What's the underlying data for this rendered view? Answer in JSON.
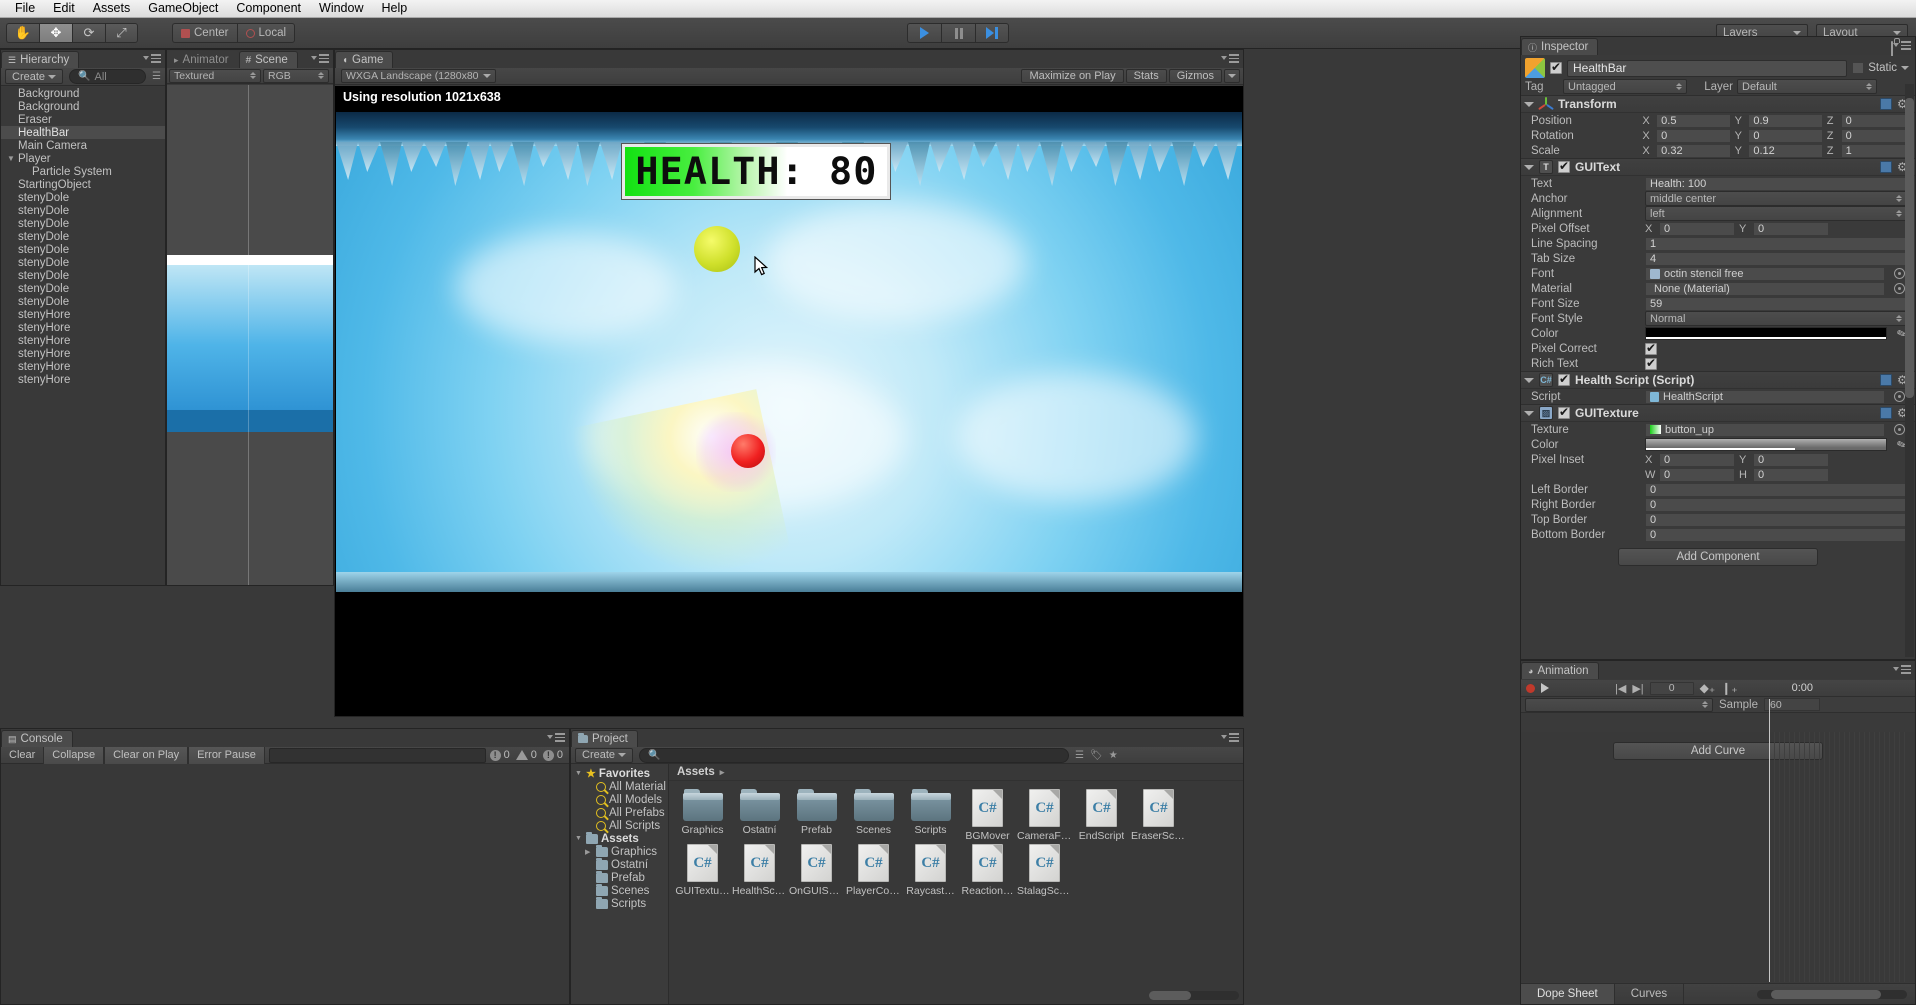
{
  "menubar": {
    "items": [
      "File",
      "Edit",
      "Assets",
      "GameObject",
      "Component",
      "Window",
      "Help"
    ]
  },
  "toolbar": {
    "tools": [
      {
        "name": "hand-tool",
        "glyph": "✋"
      },
      {
        "name": "move-tool",
        "glyph": "✥"
      },
      {
        "name": "rotate-tool",
        "glyph": "⟳"
      },
      {
        "name": "scale-tool",
        "glyph": "⤢"
      }
    ],
    "pivot_mode": "Center",
    "pivot_rotation": "Local",
    "play_label": "Play",
    "pause_label": "Pause",
    "step_label": "Step",
    "layers_label": "Layers",
    "layout_label": "Layout"
  },
  "hierarchy": {
    "tab": "Hierarchy",
    "create_label": "Create",
    "search_placeholder": "All",
    "items": [
      {
        "label": "Background",
        "indent": 0,
        "expandable": false,
        "selected": false
      },
      {
        "label": "Background",
        "indent": 0,
        "expandable": false,
        "selected": false
      },
      {
        "label": "Eraser",
        "indent": 0,
        "expandable": false,
        "selected": false
      },
      {
        "label": "HealthBar",
        "indent": 0,
        "expandable": false,
        "selected": true
      },
      {
        "label": "Main Camera",
        "indent": 0,
        "expandable": false,
        "selected": false
      },
      {
        "label": "Player",
        "indent": 0,
        "expandable": true,
        "selected": false
      },
      {
        "label": "Particle System",
        "indent": 1,
        "expandable": false,
        "selected": false
      },
      {
        "label": "StartingObject",
        "indent": 0,
        "expandable": false,
        "selected": false
      },
      {
        "label": "stenyDole",
        "indent": 0,
        "expandable": false,
        "selected": false
      },
      {
        "label": "stenyDole",
        "indent": 0,
        "expandable": false,
        "selected": false
      },
      {
        "label": "stenyDole",
        "indent": 0,
        "expandable": false,
        "selected": false
      },
      {
        "label": "stenyDole",
        "indent": 0,
        "expandable": false,
        "selected": false
      },
      {
        "label": "stenyDole",
        "indent": 0,
        "expandable": false,
        "selected": false
      },
      {
        "label": "stenyDole",
        "indent": 0,
        "expandable": false,
        "selected": false
      },
      {
        "label": "stenyDole",
        "indent": 0,
        "expandable": false,
        "selected": false
      },
      {
        "label": "stenyDole",
        "indent": 0,
        "expandable": false,
        "selected": false
      },
      {
        "label": "stenyDole",
        "indent": 0,
        "expandable": false,
        "selected": false
      },
      {
        "label": "stenyHore",
        "indent": 0,
        "expandable": false,
        "selected": false
      },
      {
        "label": "stenyHore",
        "indent": 0,
        "expandable": false,
        "selected": false
      },
      {
        "label": "stenyHore",
        "indent": 0,
        "expandable": false,
        "selected": false
      },
      {
        "label": "stenyHore",
        "indent": 0,
        "expandable": false,
        "selected": false
      },
      {
        "label": "stenyHore",
        "indent": 0,
        "expandable": false,
        "selected": false
      },
      {
        "label": "stenyHore",
        "indent": 0,
        "expandable": false,
        "selected": false
      }
    ]
  },
  "scene_panel": {
    "tab_animator": "Animator",
    "tab_scene": "Scene",
    "draw_mode": "Textured",
    "color_mode": "RGB"
  },
  "game_view": {
    "tab": "Game",
    "aspect": "WXGA Landscape (1280x80",
    "maximize_label": "Maximize on Play",
    "stats_label": "Stats",
    "gizmos_label": "Gizmos",
    "resolution_notice": "Using resolution 1021x638",
    "hud_health_text": "HEALTH: 80"
  },
  "console": {
    "tab": "Console",
    "clear_label": "Clear",
    "collapse_label": "Collapse",
    "clear_on_play_label": "Clear on Play",
    "error_pause_label": "Error Pause",
    "count_info": "0",
    "count_warning": "0",
    "count_error": "0"
  },
  "project": {
    "tab": "Project",
    "create_label": "Create",
    "search_placeholder": "",
    "favorites_label": "Favorites",
    "favorites": [
      "All Material",
      "All Models",
      "All Prefabs",
      "All Scripts"
    ],
    "assets_label": "Assets",
    "folders": [
      "Graphics",
      "Ostatní",
      "Prefab",
      "Scenes",
      "Scripts"
    ],
    "breadcrumb": "Assets",
    "items": [
      {
        "name": "Graphics",
        "type": "folder"
      },
      {
        "name": "Ostatní",
        "type": "folder"
      },
      {
        "name": "Prefab",
        "type": "folder"
      },
      {
        "name": "Scenes",
        "type": "folder"
      },
      {
        "name": "Scripts",
        "type": "folder"
      },
      {
        "name": "BGMover",
        "type": "script"
      },
      {
        "name": "CameraFo…",
        "type": "script"
      },
      {
        "name": "EndScript",
        "type": "script"
      },
      {
        "name": "EraserScr…",
        "type": "script"
      },
      {
        "name": "GUITextu…",
        "type": "script"
      },
      {
        "name": "HealthScr…",
        "type": "script"
      },
      {
        "name": "OnGUISc…",
        "type": "script"
      },
      {
        "name": "PlayerCol…",
        "type": "script"
      },
      {
        "name": "Raycast…",
        "type": "script"
      },
      {
        "name": "Reaction…",
        "type": "script"
      },
      {
        "name": "StalagScr…",
        "type": "script"
      }
    ]
  },
  "inspector": {
    "tab": "Inspector",
    "object_name": "HealthBar",
    "enabled": true,
    "static_label": "Static",
    "tag_label": "Tag",
    "tag_value": "Untagged",
    "layer_label": "Layer",
    "layer_value": "Default",
    "components": [
      {
        "title": "Transform",
        "icon": "transform-icon",
        "has_checkbox": false,
        "rows": [
          {
            "label": "Position",
            "type": "vec3",
            "x": "0.5",
            "y": "0.9",
            "z": "0"
          },
          {
            "label": "Rotation",
            "type": "vec3",
            "x": "0",
            "y": "0",
            "z": "0"
          },
          {
            "label": "Scale",
            "type": "vec3",
            "x": "0.32",
            "y": "0.12",
            "z": "1"
          }
        ]
      },
      {
        "title": "GUIText",
        "icon": "text-icon",
        "has_checkbox": true,
        "checked": true,
        "rows": [
          {
            "label": "Text",
            "type": "text",
            "value": "Health: 100"
          },
          {
            "label": "Anchor",
            "type": "select",
            "value": "middle center"
          },
          {
            "label": "Alignment",
            "type": "select",
            "value": "left"
          },
          {
            "label": "Pixel Offset",
            "type": "vec2",
            "x": "0",
            "y": "0"
          },
          {
            "label": "Line Spacing",
            "type": "text",
            "value": "1"
          },
          {
            "label": "Tab Size",
            "type": "text",
            "value": "4"
          },
          {
            "label": "Font",
            "type": "object",
            "value": "octin stencil free"
          },
          {
            "label": "Material",
            "type": "object",
            "value": "None (Material)"
          },
          {
            "label": "Font Size",
            "type": "text",
            "value": "59"
          },
          {
            "label": "Font Style",
            "type": "select",
            "value": "Normal"
          },
          {
            "label": "Color",
            "type": "color",
            "value": "#000000"
          },
          {
            "label": "Pixel Correct",
            "type": "check",
            "checked": true
          },
          {
            "label": "Rich Text",
            "type": "check",
            "checked": true
          }
        ]
      },
      {
        "title": "Health Script (Script)",
        "icon": "csharp-icon",
        "has_checkbox": true,
        "checked": true,
        "rows": [
          {
            "label": "Script",
            "type": "object",
            "value": "HealthScript"
          }
        ]
      },
      {
        "title": "GUITexture",
        "icon": "texture-icon",
        "has_checkbox": true,
        "checked": true,
        "rows": [
          {
            "label": "Texture",
            "type": "object",
            "value": "button_up"
          },
          {
            "label": "Color",
            "type": "color",
            "value": "#808080"
          },
          {
            "label": "Pixel Inset",
            "type": "inset",
            "x": "0",
            "y": "0",
            "w": "0",
            "h": "0"
          },
          {
            "label": "Left Border",
            "type": "text",
            "value": "0"
          },
          {
            "label": "Right Border",
            "type": "text",
            "value": "0"
          },
          {
            "label": "Top Border",
            "type": "text",
            "value": "0"
          },
          {
            "label": "Bottom Border",
            "type": "text",
            "value": "0"
          }
        ]
      }
    ],
    "add_component_label": "Add Component"
  },
  "animation": {
    "tab": "Animation",
    "frame_value": "0",
    "sample_label": "Sample",
    "sample_value": "60",
    "timecode": "0:00",
    "add_curve_label": "Add Curve",
    "dope_sheet_label": "Dope Sheet",
    "curves_label": "Curves"
  },
  "colors": {
    "accent_blue": "#3b8fe0",
    "panel_bg": "#393939",
    "selection": "#4c4c4c",
    "health_green": "#12e212",
    "csharp_blue": "#3d7fa6"
  }
}
